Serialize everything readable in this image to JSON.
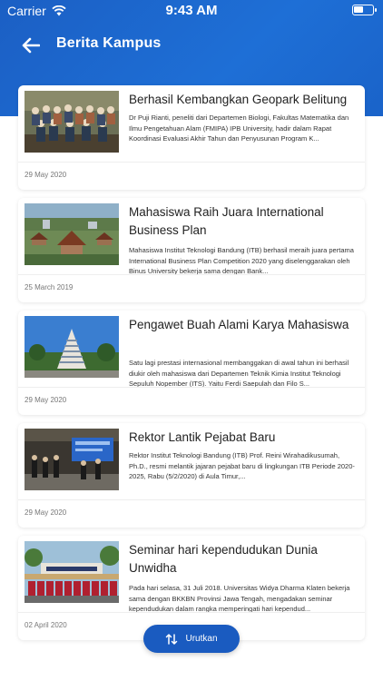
{
  "status_bar": {
    "carrier": "Carrier",
    "time": "9:43 AM"
  },
  "header": {
    "title": "Berita Kampus",
    "back_icon": "arrow-left-icon"
  },
  "articles": [
    {
      "title": "Berhasil Kembangkan Geopark Belitung",
      "description": "Dr Puji Rianti, peneliti dari Departemen Biologi, Fakultas Matematika dan Ilmu Pengetahuan Alam (FMIPA) IPB University, hadir dalam Rapat Koordinasi Evaluasi Akhir Tahun dan Penyusunan Program K...",
      "date": "29 May 2020"
    },
    {
      "title": "Mahasiswa Raih Juara International Business Plan",
      "description": "Mahasiswa Institut Teknologi Bandung (ITB) berhasil meraih juara pertama International Business Plan Competition 2020 yang diselenggarakan oleh Binus University bekerja sama dengan Bank...",
      "date": "25 March 2019"
    },
    {
      "title": "Pengawet Buah Alami Karya Mahasiswa",
      "description": "Satu lagi prestasi internasional membanggakan di awal tahun ini berhasil diukir oleh mahasiswa dari Departemen Teknik Kimia Institut Teknologi Sepuluh Nopember (ITS). Yaitu Ferdi Saepulah dan Filo S...",
      "date": "29 May 2020"
    },
    {
      "title": "Rektor Lantik Pejabat Baru",
      "description": "Rektor Institut Teknologi Bandung (ITB) Prof. Reini Wirahadikusumah, Ph.D., resmi melantik jajaran pejabat baru di lingkungan ITB Periode 2020-2025, Rabu (5/2/2020) di Aula Timur,...",
      "date": "29 May 2020"
    },
    {
      "title": "Seminar hari kependudukan Dunia Unwidha",
      "description": "Pada hari selasa, 31 Juli 2018. Universitas Widya Dharma Klaten bekerja sama dengan BKKBN Provinsi Jawa Tengah, mengadakan seminar kependudukan dalam rangka memperingati hari kependud...",
      "date": "02 April 2020"
    }
  ],
  "sort_button": {
    "label": "Urutkan",
    "icon": "sort-arrows-icon"
  },
  "colors": {
    "primary": "#1a5bc0",
    "header": "#1e6fd6"
  }
}
